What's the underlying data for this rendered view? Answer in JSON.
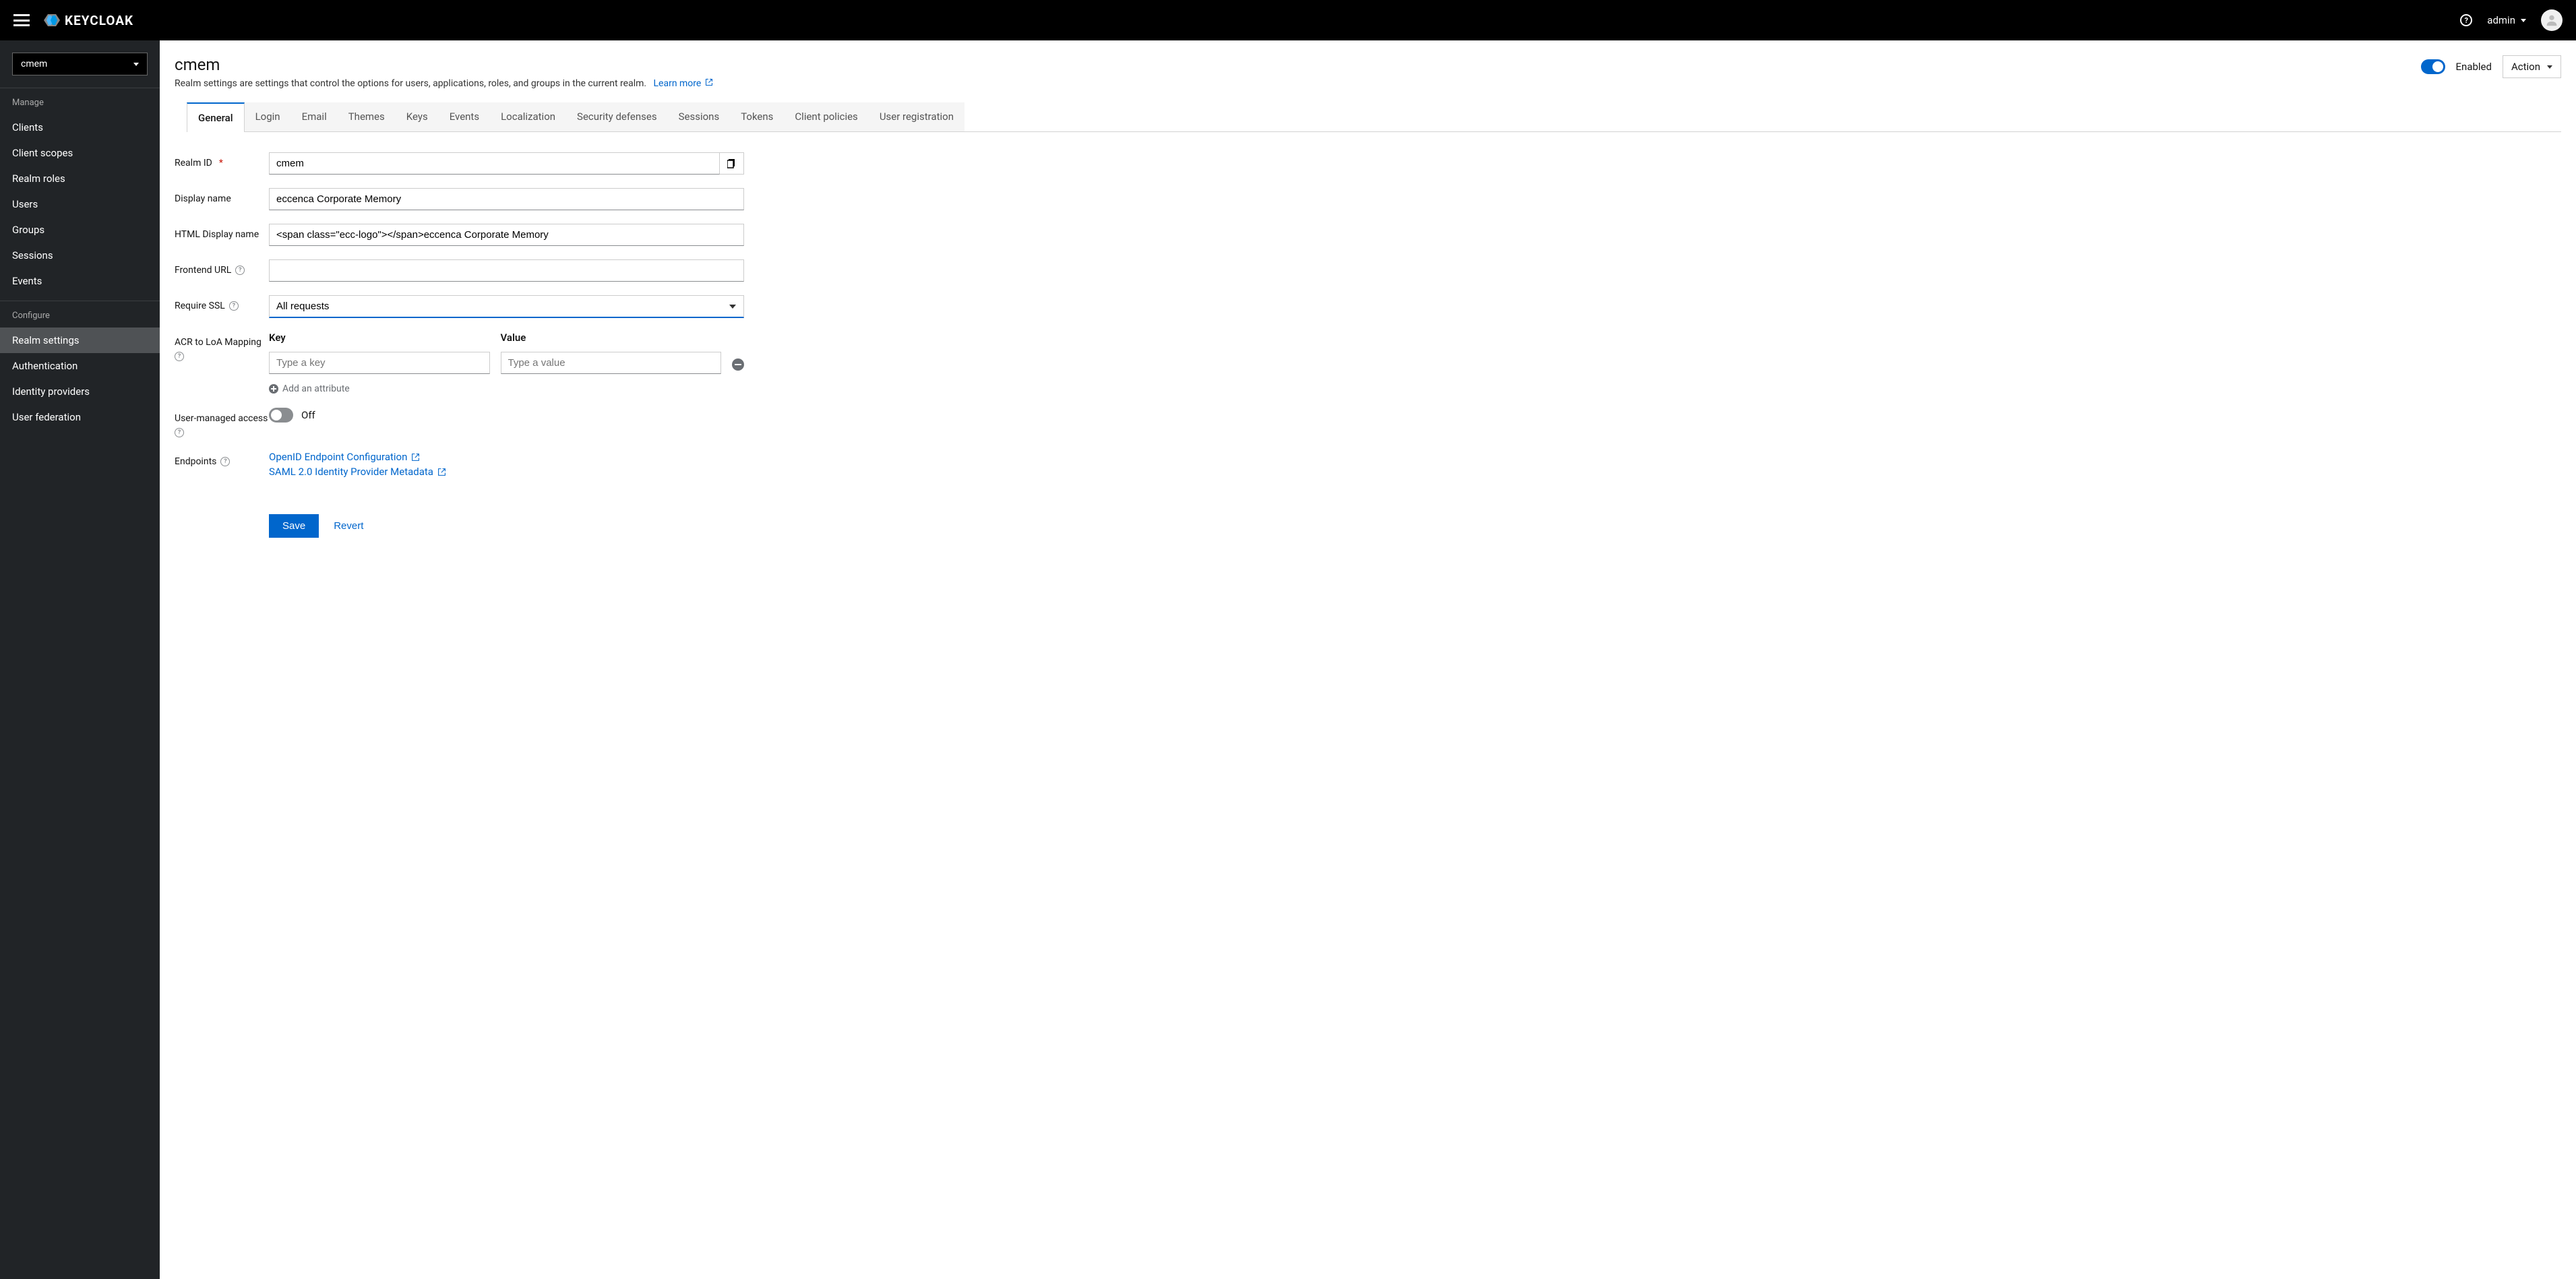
{
  "topbar": {
    "logo_text": "KEYCLOAK",
    "username": "admin"
  },
  "sidebar": {
    "realm_select": "cmem",
    "manage_title": "Manage",
    "manage_items": [
      "Clients",
      "Client scopes",
      "Realm roles",
      "Users",
      "Groups",
      "Sessions",
      "Events"
    ],
    "configure_title": "Configure",
    "configure_items": [
      "Realm settings",
      "Authentication",
      "Identity providers",
      "User federation"
    ],
    "active": "Realm settings"
  },
  "page": {
    "title": "cmem",
    "description": "Realm settings are settings that control the options for users, applications, roles, and groups in the current realm.",
    "learn_more": "Learn more",
    "enabled_label": "Enabled",
    "action_label": "Action"
  },
  "tabs": [
    "General",
    "Login",
    "Email",
    "Themes",
    "Keys",
    "Events",
    "Localization",
    "Security defenses",
    "Sessions",
    "Tokens",
    "Client policies",
    "User registration"
  ],
  "active_tab": "General",
  "form": {
    "realm_id": {
      "label": "Realm ID",
      "value": "cmem"
    },
    "display_name": {
      "label": "Display name",
      "value": "eccenca Corporate Memory"
    },
    "html_display_name": {
      "label": "HTML Display name",
      "value": "<span class=\"ecc-logo\"></span>eccenca Corporate Memory"
    },
    "frontend_url": {
      "label": "Frontend URL",
      "value": ""
    },
    "require_ssl": {
      "label": "Require SSL",
      "value": "All requests"
    },
    "acr_map": {
      "label": "ACR to LoA Mapping",
      "key_header": "Key",
      "value_header": "Value",
      "key_placeholder": "Type a key",
      "value_placeholder": "Type a value",
      "add_label": "Add an attribute"
    },
    "user_managed": {
      "label": "User-managed access",
      "off_label": "Off"
    },
    "endpoints": {
      "label": "Endpoints",
      "links": [
        "OpenID Endpoint Configuration",
        "SAML 2.0 Identity Provider Metadata"
      ]
    },
    "save": "Save",
    "revert": "Revert"
  }
}
